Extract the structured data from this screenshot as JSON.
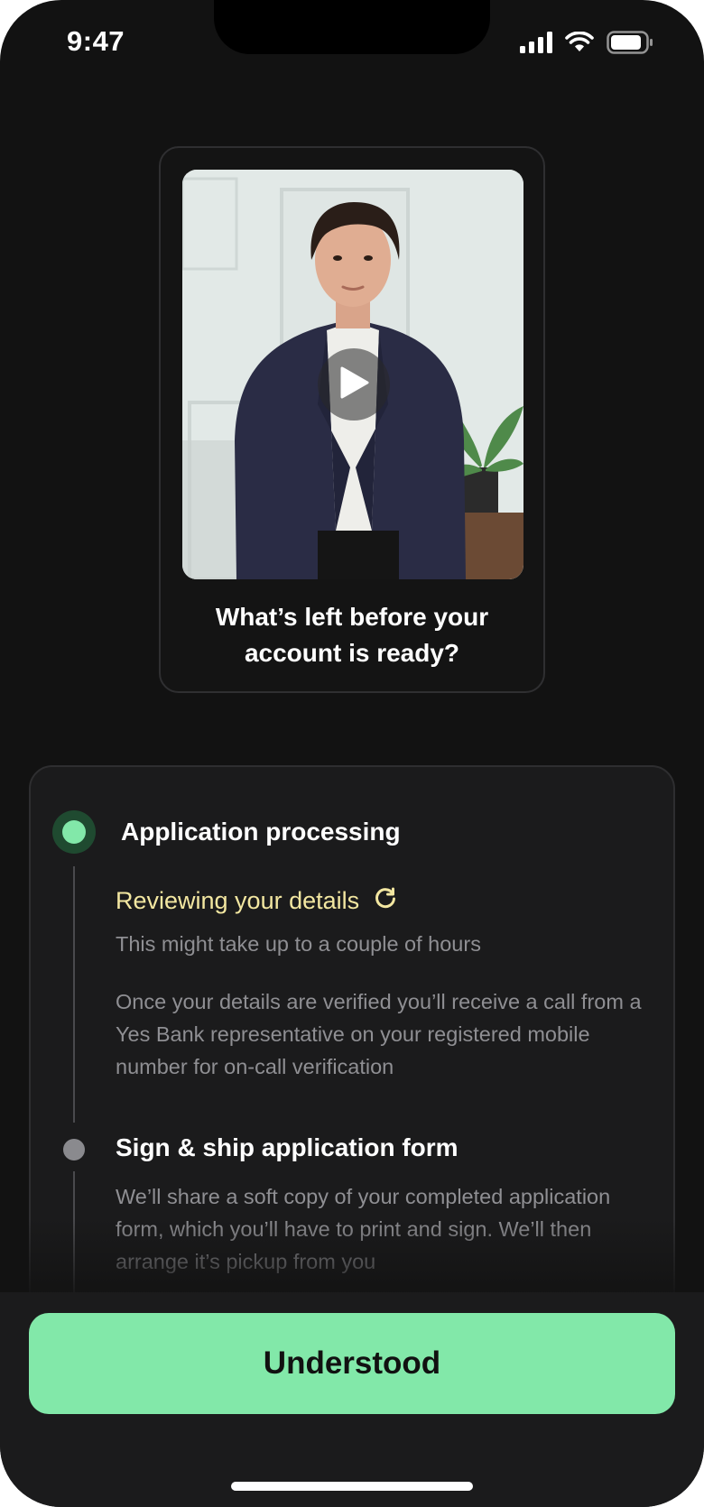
{
  "status_bar": {
    "time": "9:47"
  },
  "video": {
    "caption": "What’s left before your account is ready?",
    "play_icon": "play-icon"
  },
  "steps": [
    {
      "title": "Application processing",
      "state": "active",
      "substep": {
        "title": "Reviewing your details",
        "icon": "refresh-icon"
      },
      "paragraphs": [
        "This might take up to a couple of hours",
        "Once your details are verified you’ll receive a call from a Yes Bank representative on your registered mobile number for on-call verification"
      ]
    },
    {
      "title": "Sign & ship application form",
      "state": "pending",
      "paragraphs": [
        "We’ll share a soft copy of your completed application form, which you’ll have to print and sign. We’ll then arrange it’s pickup from you"
      ]
    }
  ],
  "cta": {
    "label": "Understood"
  },
  "colors": {
    "accent": "#82e8a9",
    "substep_title": "#f3e7a1",
    "background": "#121212",
    "card": "#1b1b1c",
    "muted_text": "#8f8f93"
  }
}
